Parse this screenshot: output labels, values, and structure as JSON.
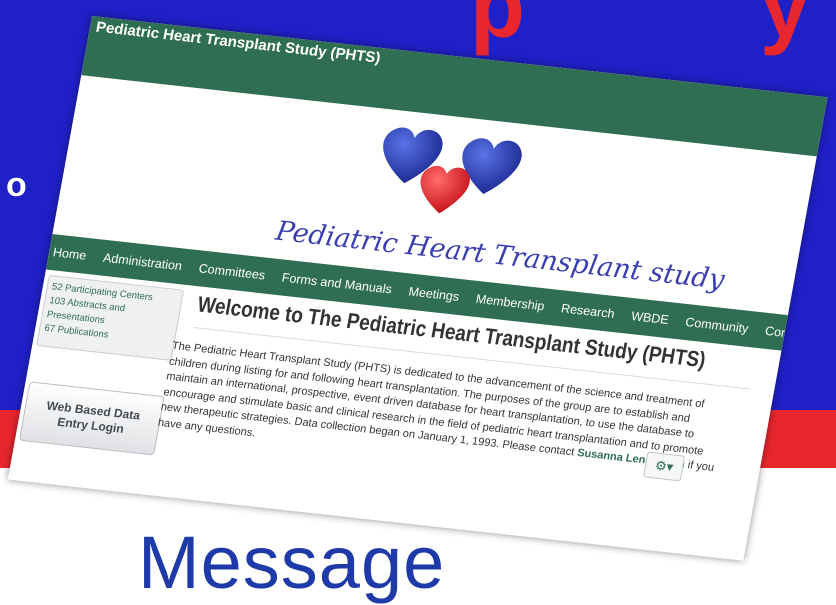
{
  "slide": {
    "title_fragment": "p",
    "title_fragment_right": "y",
    "left_fragment": "o",
    "bottom_text": "Message"
  },
  "site": {
    "title": "Pediatric Heart Transplant Study (PHTS)",
    "logo_text": "Pediatric Heart Transplant study",
    "nav": [
      "Home",
      "Administration",
      "Committees",
      "Forms and Manuals",
      "Meetings",
      "Membership",
      "Research",
      "WBDE",
      "Community",
      "Contact Us"
    ],
    "stats": [
      "52 Participating Centers",
      "103 Abstracts and Presentations",
      "67 Publications"
    ],
    "login_label": "Web Based Data Entry Login",
    "welcome_heading": "Welcome to The Pediatric Heart Transplant Study (PHTS)",
    "body_text": "The Pediatric Heart Transplant Study (PHTS) is dedicated to the advancement of the science and treatment of children during listing for and following heart transplantation. The purposes of the group are to establish and maintain an international, prospective, event driven database for heart transplantation, to use the database to encourage and stimulate basic and clinical research in the field of pediatric heart transplantation and to promote new therapeutic strategies. Data collection began on January 1, 1993. Please contact",
    "contact_name": "Susanna Lenderman",
    "body_text_end": "if you have any questions.",
    "gear_label": "⚙▾"
  },
  "colors": {
    "slide_blue": "#2020c8",
    "slide_red": "#e8262e",
    "site_green": "#2f6e52",
    "heart_blue": "#2b3fb6",
    "heart_red": "#e8262e"
  }
}
